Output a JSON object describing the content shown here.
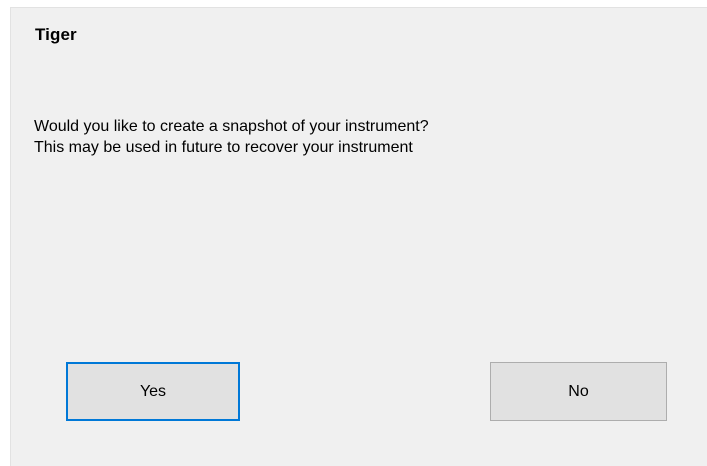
{
  "dialog": {
    "title": "Tiger",
    "message_lines": [
      "Would you like to create a snapshot of your instrument?",
      "This may be used in future to recover your instrument"
    ],
    "buttons": {
      "yes_label": "Yes",
      "no_label": "No"
    },
    "colors": {
      "background": "#f0f0f0",
      "button_face": "#e1e1e1",
      "focus_border": "#0078d7"
    }
  }
}
